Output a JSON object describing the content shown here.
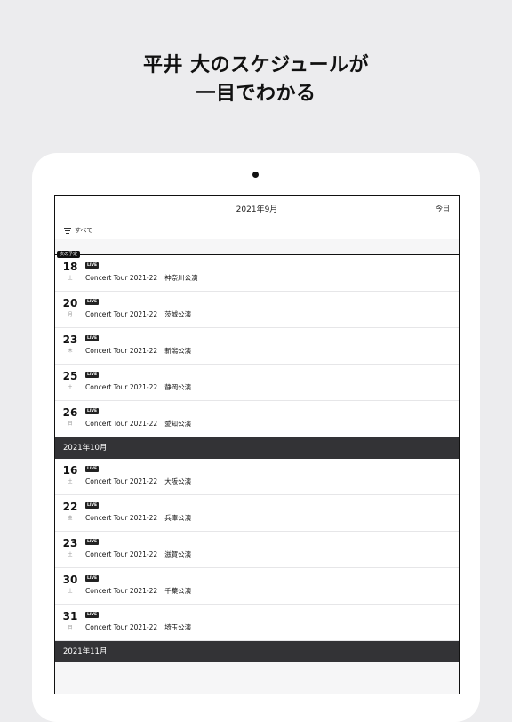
{
  "headline": {
    "line1": "平井 大のスケジュールが",
    "line2": "一目でわかる"
  },
  "screen": {
    "title": "2021年9月",
    "today_label": "今日",
    "filter_label": "すべて",
    "upnext_label": "次の予定",
    "sections": [
      {
        "events": [
          {
            "day": "18",
            "weekday": "土",
            "badge": "LIVE",
            "title": "Concert Tour 2021-22",
            "city": "神奈川公演"
          },
          {
            "day": "20",
            "weekday": "月",
            "badge": "LIVE",
            "title": "Concert Tour 2021-22",
            "city": "茨城公演"
          },
          {
            "day": "23",
            "weekday": "木",
            "badge": "LIVE",
            "title": "Concert Tour 2021-22",
            "city": "新潟公演"
          },
          {
            "day": "25",
            "weekday": "土",
            "badge": "LIVE",
            "title": "Concert Tour 2021-22",
            "city": "静岡公演"
          },
          {
            "day": "26",
            "weekday": "日",
            "badge": "LIVE",
            "title": "Concert Tour 2021-22",
            "city": "愛知公演"
          }
        ]
      },
      {
        "month": "2021年10月",
        "events": [
          {
            "day": "16",
            "weekday": "土",
            "badge": "LIVE",
            "title": "Concert Tour 2021-22",
            "city": "大阪公演"
          },
          {
            "day": "22",
            "weekday": "金",
            "badge": "LIVE",
            "title": "Concert Tour 2021-22",
            "city": "兵庫公演"
          },
          {
            "day": "23",
            "weekday": "土",
            "badge": "LIVE",
            "title": "Concert Tour 2021-22",
            "city": "滋賀公演"
          },
          {
            "day": "30",
            "weekday": "土",
            "badge": "LIVE",
            "title": "Concert Tour 2021-22",
            "city": "千葉公演"
          },
          {
            "day": "31",
            "weekday": "日",
            "badge": "LIVE",
            "title": "Concert Tour 2021-22",
            "city": "埼玉公演"
          }
        ]
      },
      {
        "month": "2021年11月",
        "events": []
      }
    ]
  }
}
